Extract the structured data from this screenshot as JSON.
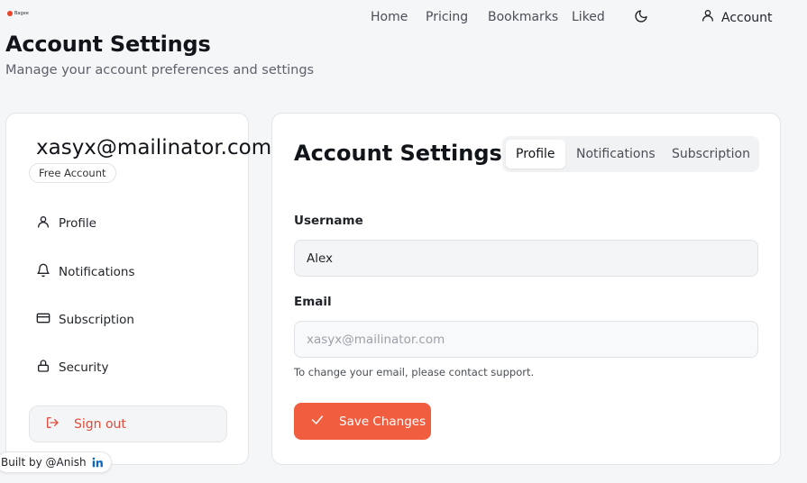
{
  "brand": {
    "logo_text": "Bagee",
    "accent": "#f05d3f"
  },
  "nav": {
    "links": [
      "Home",
      "Pricing",
      "Bookmarks",
      "Liked"
    ],
    "theme_icon": "moon-icon",
    "account_label": "Account"
  },
  "header": {
    "title": "Account Settings",
    "subtitle": "Manage your account preferences and settings"
  },
  "sidebar": {
    "email": "xasyx@mailinator.com",
    "plan_badge": "Free Account",
    "items": [
      {
        "label": "Profile",
        "icon": "user-icon"
      },
      {
        "label": "Notifications",
        "icon": "bell-icon"
      },
      {
        "label": "Subscription",
        "icon": "credit-card-icon"
      },
      {
        "label": "Security",
        "icon": "lock-icon"
      }
    ],
    "signout_label": "Sign out"
  },
  "main": {
    "title": "Account Settings",
    "tabs": [
      {
        "label": "Profile",
        "active": true
      },
      {
        "label": "Notifications",
        "active": false
      },
      {
        "label": "Subscription",
        "active": false
      }
    ],
    "username": {
      "label": "Username",
      "value": "Alex"
    },
    "email": {
      "label": "Email",
      "placeholder": "xasyx@mailinator.com",
      "help": "To change your email, please contact support."
    },
    "save_label": "Save Changes"
  },
  "footer": {
    "built_by": "Built by @Anish",
    "social_icon": "linkedin-icon"
  }
}
